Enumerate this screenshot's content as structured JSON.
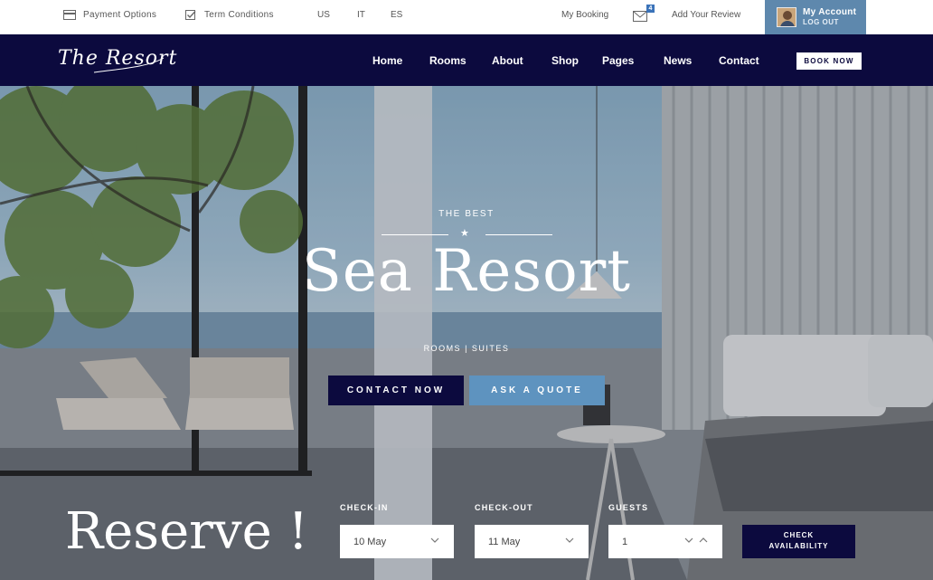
{
  "topbar": {
    "payment_label": "Payment Options",
    "terms_label": "Term Conditions",
    "languages": [
      "US",
      "IT",
      "ES"
    ],
    "booking_label": "My Booking",
    "mail_count": "4",
    "review_label": "Add Your Review",
    "account_title": "My Account",
    "account_logout": "LOG OUT"
  },
  "navbar": {
    "logo_text": "The Resort",
    "links": [
      "Home",
      "Rooms",
      "About",
      "Shop",
      "Pages",
      "News",
      "Contact"
    ],
    "book_label": "BOOK NOW",
    "bg_color": "#0c0a3e"
  },
  "hero": {
    "eyebrow": "THE BEST",
    "title": "Sea Resort",
    "subtitle": "ROOMS | SUITES",
    "contact_button": "CONTACT NOW",
    "quote_button": "ASK A QUOTE",
    "accent_color": "#5e93bf"
  },
  "reservation": {
    "title": "Reserve !",
    "checkin_label": "CHECK-IN",
    "checkin_value": "10 May",
    "checkout_label": "CHECK-OUT",
    "checkout_value": "11 May",
    "guests_label": "GUESTS",
    "guests_value": "1",
    "check_button_line1": "CHECK",
    "check_button_line2": "AVAILABILITY"
  },
  "icons": {
    "payment": "credit-card-icon",
    "terms": "checkbox-icon",
    "mail": "envelope-icon",
    "star": "star-icon",
    "chevron": "chevron-down-icon",
    "stepper": "chevron-up-icon"
  }
}
